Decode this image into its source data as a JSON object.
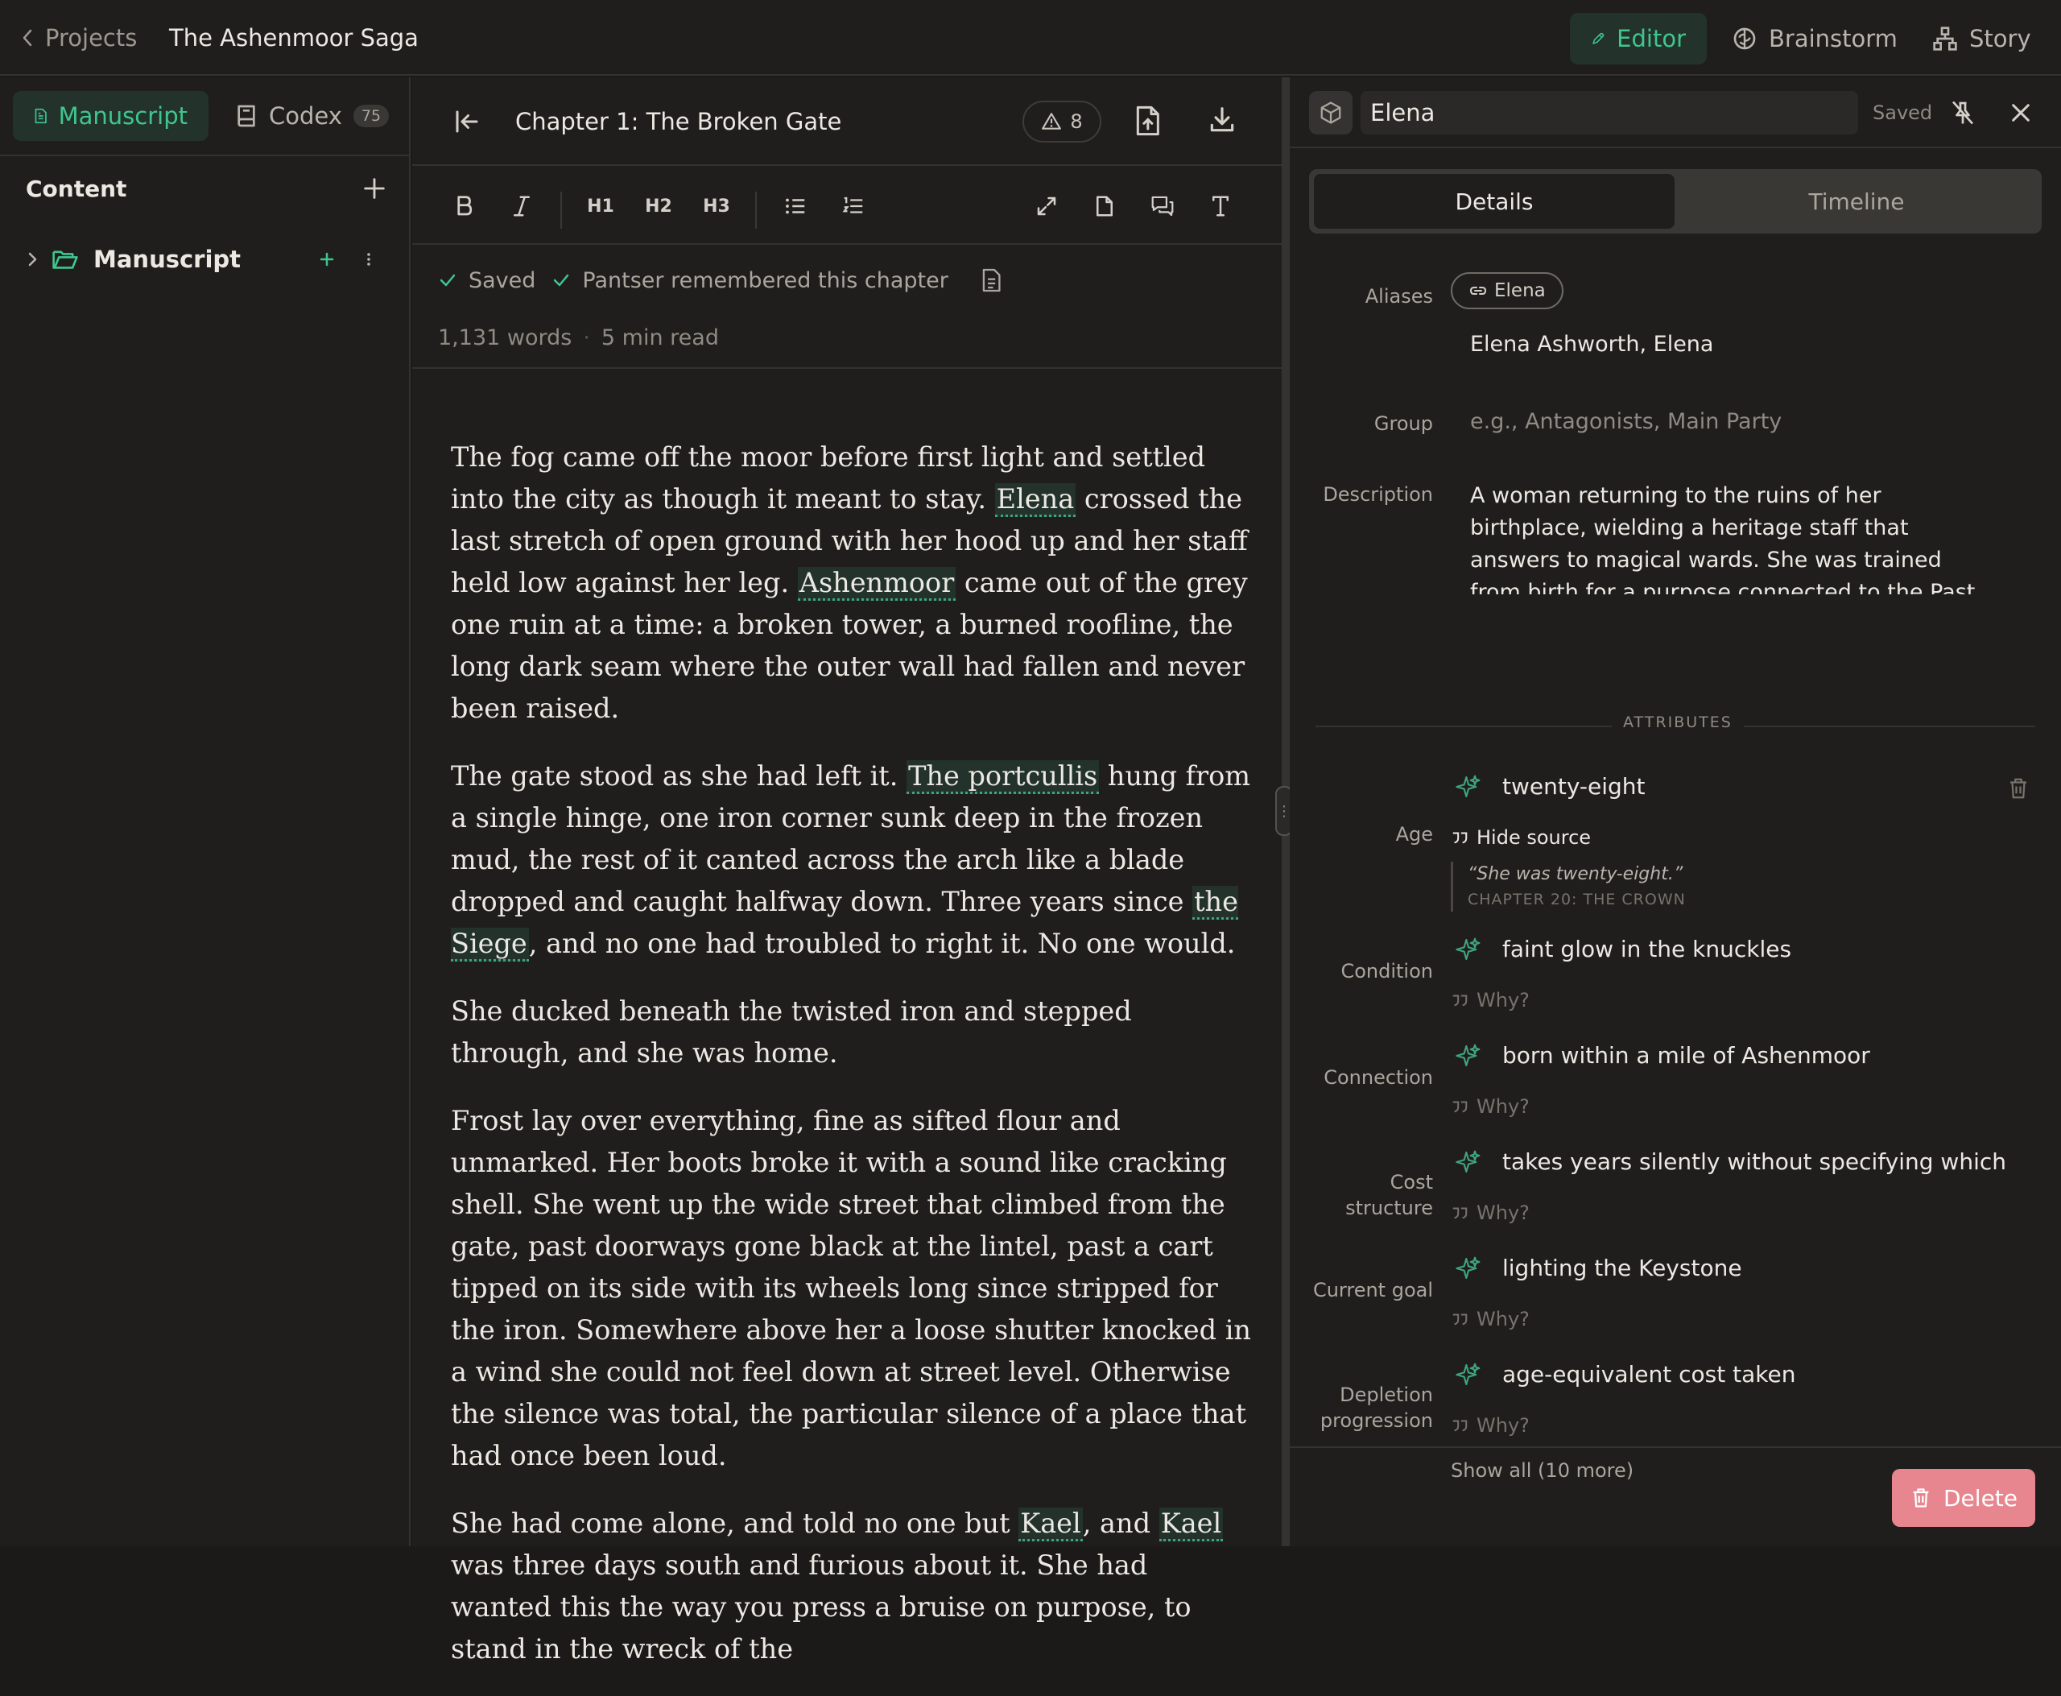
{
  "topbar": {
    "back_label": "Projects",
    "project_title": "The Ashenmoor Saga",
    "tabs": [
      {
        "label": "Editor",
        "active": true
      },
      {
        "label": "Brainstorm",
        "active": false
      },
      {
        "label": "Story",
        "active": false
      }
    ]
  },
  "sidebar": {
    "tabs": [
      {
        "label": "Manuscript",
        "active": true
      },
      {
        "label": "Codex",
        "count": "75",
        "active": false
      }
    ],
    "content_label": "Content",
    "tree": [
      {
        "label": "Manuscript",
        "expanded": false
      }
    ]
  },
  "editor": {
    "chapter_title": "Chapter 1: The Broken Gate",
    "warnings_count": "8",
    "toolbar": {
      "h1": "H1",
      "h2": "H2",
      "h3": "H3"
    },
    "status": {
      "saved": "Saved",
      "remembered": "Pantser remembered this chapter"
    },
    "stats": {
      "words": "1,131 words",
      "separator": "·",
      "read_time": "5 min read"
    },
    "paragraphs": [
      [
        {
          "t": "The fog came off the moor before first light and settled into the city as though it meant to stay. "
        },
        {
          "t": "Elena",
          "entity": true
        },
        {
          "t": " crossed the last stretch of open ground with her hood up and her staff held low against her leg. "
        },
        {
          "t": "Ashenmoor",
          "entity": true
        },
        {
          "t": " came out of the grey one ruin at a time: a broken tower, a burned roofline, the long dark seam where the outer wall had fallen and never been raised."
        }
      ],
      [
        {
          "t": "The gate stood as she had left it. "
        },
        {
          "t": "The portcullis",
          "entity": true
        },
        {
          "t": " hung from a single hinge, one iron corner sunk deep in the frozen mud, the rest of it canted across the arch like a blade dropped and caught halfway down. Three years since "
        },
        {
          "t": "the Siege",
          "entity": true
        },
        {
          "t": ", and no one had troubled to right it. No one would."
        }
      ],
      [
        {
          "t": "She ducked beneath the twisted iron and stepped through, and she was home."
        }
      ],
      [
        {
          "t": "Frost lay over everything, fine as sifted flour and unmarked. Her boots broke it with a sound like cracking shell. She went up the wide street that climbed from the gate, past doorways gone black at the lintel, past a cart tipped on its side with its wheels long since stripped for the iron. Somewhere above her a loose shutter knocked in a wind she could not feel down at street level. Otherwise the silence was total, the particular silence of a place that had once been loud."
        }
      ],
      [
        {
          "t": "She had come alone, and told no one but "
        },
        {
          "t": "Kael",
          "entity": true
        },
        {
          "t": ", and "
        },
        {
          "t": "Kael",
          "entity": true
        },
        {
          "t": " was three days south and furious about it. She had wanted this the way you press a bruise on purpose, to stand in the wreck of the"
        }
      ]
    ]
  },
  "panel": {
    "entity_name": "Elena",
    "saved_label": "Saved",
    "segments": [
      {
        "label": "Details",
        "active": true
      },
      {
        "label": "Timeline",
        "active": false
      }
    ],
    "fields": {
      "aliases_label": "Aliases",
      "alias_chip": "Elena",
      "aliases_value": "Elena Ashworth, Elena",
      "group_label": "Group",
      "group_placeholder": "e.g., Antagonists, Main Party",
      "description_label": "Description",
      "description_value": "A woman returning to the ruins of her birthplace, wielding a heritage staff that answers to magical wards. She was trained from birth for a purpose connected to the Past but spent years trying to"
    },
    "attributes_heading": "ATTRIBUTES",
    "age": {
      "label": "Age",
      "value": "twenty-eight",
      "hide_source": "Hide source",
      "quote": "“She was twenty-eight.”",
      "quote_source": "CHAPTER 20: THE CROWN"
    },
    "attributes": [
      {
        "label": "Condition",
        "value": "faint glow in the knuckles",
        "why": "Why?"
      },
      {
        "label": "Connection",
        "value": "born within a mile of Ashenmoor",
        "why": "Why?"
      },
      {
        "label": "Cost structure",
        "value": "takes years silently without specifying which",
        "why": "Why?"
      },
      {
        "label": "Current goal",
        "value": "lighting the Keystone",
        "why": "Why?"
      },
      {
        "label": "Depletion progression",
        "value": "age-equivalent cost taken",
        "why": "Why?"
      }
    ],
    "show_all": "Show all (10 more)",
    "delete_label": "Delete"
  },
  "colors": {
    "accent": "#3fc68e",
    "background": "#1f1e1d",
    "delete": "#e7868f"
  }
}
